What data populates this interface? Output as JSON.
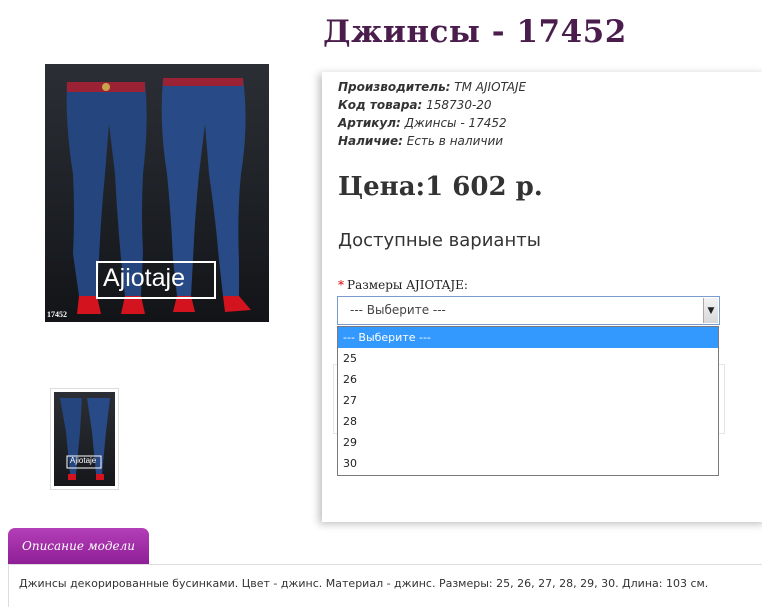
{
  "product": {
    "title": "Джинсы - 17452",
    "image_code": "17452",
    "brand_logo": "Ajiotaje",
    "thumb_logo": "Ajiotaje"
  },
  "info": {
    "manufacturer_label": "Производитель:",
    "manufacturer_value": "ТМ AJIOTAJE",
    "code_label": "Код товара:",
    "code_value": "158730-20",
    "article_label": "Артикул:",
    "article_value": "Джинсы - 17452",
    "stock_label": "Наличие:",
    "stock_value": "Есть в наличии"
  },
  "price": "Цена:1 602 р.",
  "variants": {
    "title": "Доступные варианты",
    "required_mark": "*",
    "size_label": "Размеры AJIOTAJE:",
    "selected": "--- Выберите ---",
    "options": [
      "--- Выберите ---",
      "25",
      "26",
      "27",
      "28",
      "29",
      "30"
    ]
  },
  "tabs": {
    "description_label": "Описание модели"
  },
  "description": "Джинсы декорированные бусинками. Цвет - джинс. Материал - джинс. Размеры: 25, 26, 27, 28, 29, 30. Длина: 103 см.",
  "colors": {
    "title": "#4a1d4d",
    "tab": "#a02ea8",
    "option_highlight": "#3399ff"
  }
}
